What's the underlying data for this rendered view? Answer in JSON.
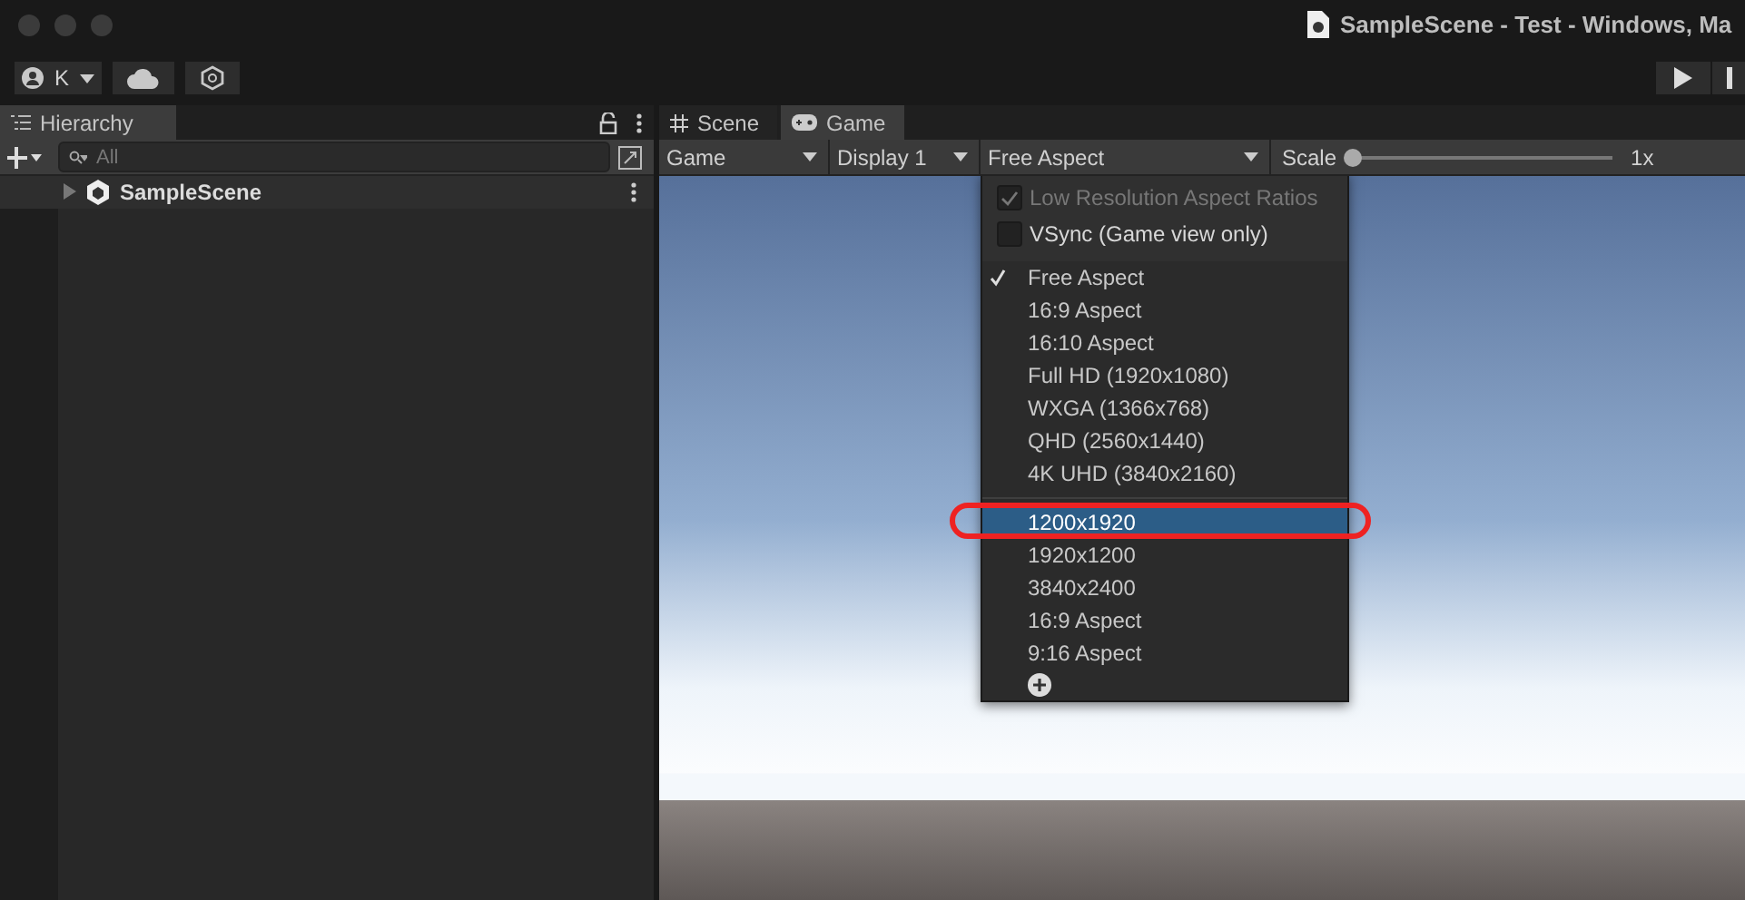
{
  "window": {
    "title": "SampleScene - Test - Windows, Ma"
  },
  "toolbar": {
    "account": "K"
  },
  "hierarchy": {
    "tab": {
      "label": "Hierarchy",
      "selected": true
    },
    "search": {
      "placeholder": "All"
    },
    "items": [
      {
        "label": "SampleScene",
        "expanded": false
      }
    ]
  },
  "view_tabs": [
    {
      "label": "Scene",
      "selected": false
    },
    {
      "label": "Game",
      "selected": true
    }
  ],
  "game_toolbar": {
    "mode": "Game",
    "display": "Display 1",
    "aspect": "Free Aspect",
    "scale_label": "Scale",
    "scale": {
      "level": 0.0
    },
    "scale_reading": "1x"
  },
  "aspect_menu": {
    "options": [
      {
        "label": "Low Resolution Aspect Ratios",
        "checked": true,
        "disabled": true
      },
      {
        "label": "VSync (Game view only)",
        "checked": false,
        "disabled": false
      }
    ],
    "groups": [
      [
        {
          "label": "Free Aspect",
          "checked": true,
          "selected": false
        },
        {
          "label": "16:9 Aspect",
          "checked": false,
          "selected": false
        },
        {
          "label": "16:10 Aspect",
          "checked": false,
          "selected": false
        },
        {
          "label": "Full HD (1920x1080)",
          "checked": false,
          "selected": false
        },
        {
          "label": "WXGA (1366x768)",
          "checked": false,
          "selected": false
        },
        {
          "label": "QHD (2560x1440)",
          "checked": false,
          "selected": false
        },
        {
          "label": "4K UHD (3840x2160)",
          "checked": false,
          "selected": false
        }
      ],
      [
        {
          "label": "1200x1920",
          "checked": false,
          "selected": true
        },
        {
          "label": "1920x1200",
          "checked": false,
          "selected": false
        },
        {
          "label": "3840x2400",
          "checked": false,
          "selected": false
        },
        {
          "label": "16:9 Aspect",
          "checked": false,
          "selected": false
        },
        {
          "label": "9:16 Aspect",
          "checked": false,
          "selected": false
        }
      ]
    ]
  }
}
